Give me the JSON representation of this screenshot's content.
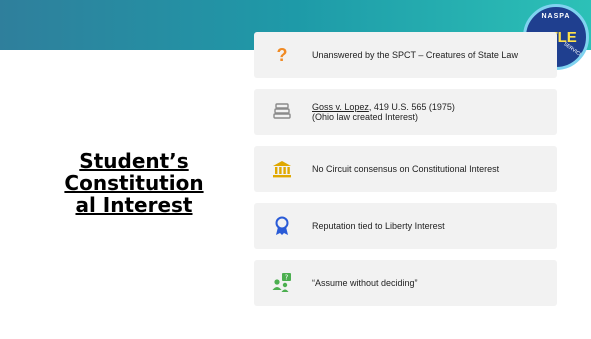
{
  "title": "Student’s Constitutional Interest",
  "title_lines": [
    "Student’s",
    "Constitution",
    "al Interest"
  ],
  "badge": {
    "top": "NASPA",
    "mid": "TITLE",
    "arc": "SERVICE"
  },
  "items": [
    {
      "icon": "question-mark-icon",
      "text": "Unanswered by the SPCT – Creatures of State Law"
    },
    {
      "icon": "books-icon",
      "case": "Goss v. Lopez",
      "cite": ", 419 U.S. 565 (1975)",
      "note": "(Ohio law created Interest)"
    },
    {
      "icon": "courthouse-icon",
      "text": "No Circuit consensus on Constitutional Interest"
    },
    {
      "icon": "award-ribbon-icon",
      "text": "Reputation tied to Liberty Interest"
    },
    {
      "icon": "people-question-icon",
      "text": "“Assume without deciding”"
    }
  ],
  "colors": {
    "bar_start": "#2f7f9c",
    "bar_end": "#2cc1b7",
    "card_bg": "#f2f2f2",
    "orange": "#f08a24",
    "gold": "#e0a800",
    "blue": "#2a5bd7",
    "green": "#4caf50"
  }
}
